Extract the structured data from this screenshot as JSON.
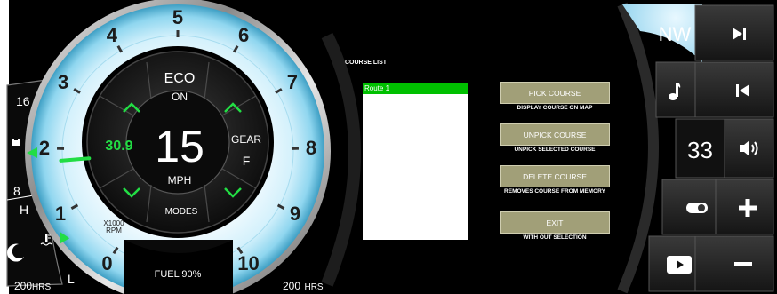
{
  "gauge": {
    "ticks": [
      "0",
      "1",
      "2",
      "3",
      "4",
      "5",
      "6",
      "7",
      "8",
      "9",
      "10"
    ],
    "rpm_unit": "X1000",
    "rpm_label": "RPM",
    "eco_label": "ECO",
    "eco_value": "ON",
    "speed_value": "15",
    "speed_unit": "MPH",
    "speed_set_value": "30.9",
    "gear_label": "GEAR",
    "gear_value": "F",
    "modes_label": "MODES",
    "fuel_text": "FUEL 90%",
    "fuel_level_pct": 90,
    "rpm_value": 1.8
  },
  "left_gauge": {
    "top_value": "16",
    "mid_value": "8",
    "h_label": "H",
    "l_label": "L",
    "hours_value": "200",
    "hours_unit": "HRS"
  },
  "right_hours": {
    "value": "200",
    "unit": "HRS"
  },
  "course": {
    "title": "COURSE LIST",
    "routes": [
      "Route 1"
    ],
    "buttons": [
      {
        "label": "PICK COURSE",
        "desc": "DISPLAY COURSE ON MAP"
      },
      {
        "label": "UNPICK COURSE",
        "desc": "UNPICK SELECTED COURSE"
      },
      {
        "label": "DELETE COURSE",
        "desc": "REMOVES COURSE FROM MEMORY"
      },
      {
        "label": "EXIT",
        "desc": "WITH OUT SELECTION"
      }
    ]
  },
  "right_panel": {
    "heading": "NW",
    "volume_value": "33"
  },
  "colors": {
    "accent_green": "#22dd44",
    "glow_blue": "#bfeaf9",
    "button_olive": "#a19f78",
    "route_selected": "#00c000"
  },
  "icons": [
    "next-track-icon",
    "music-note-icon",
    "previous-track-icon",
    "volume-icon",
    "toggle-icon",
    "plus-icon",
    "play-icon",
    "minus-icon",
    "moon-icon",
    "battery-icon",
    "temperature-icon",
    "chevron-up-icon",
    "chevron-down-icon"
  ]
}
